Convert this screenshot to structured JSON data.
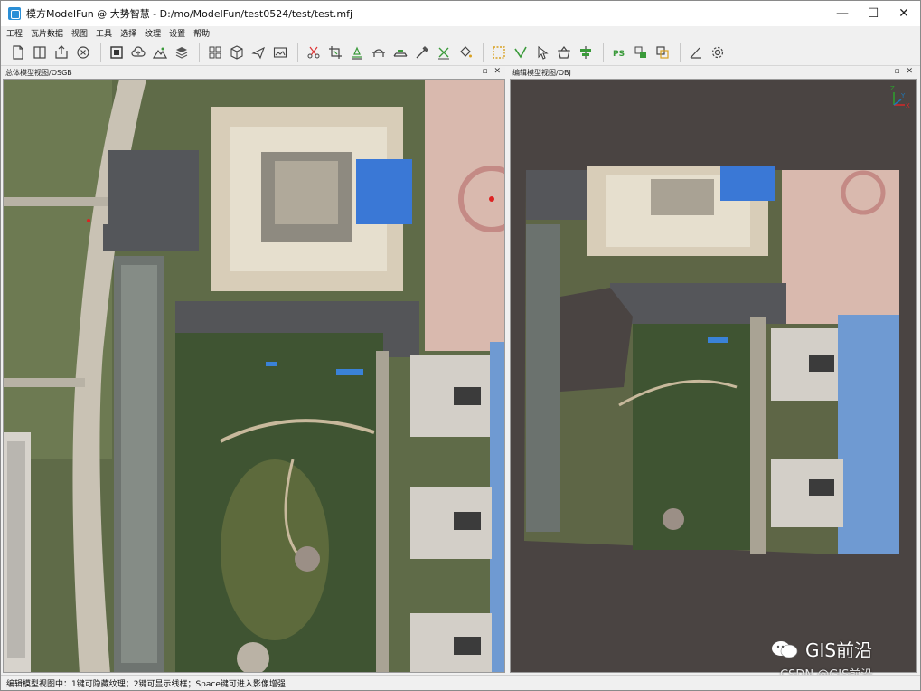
{
  "window": {
    "title": "模方ModelFun @ 大势智慧 - D:/mo/ModelFun/test0524/test/test.mfj"
  },
  "window_controls": {
    "minimize": "—",
    "maximize": "☐",
    "close": "✕"
  },
  "menu": [
    "工程",
    "瓦片数据",
    "视图",
    "工具",
    "选择",
    "纹理",
    "设置",
    "帮助"
  ],
  "toolbar_icons": [
    "new-file-icon",
    "split-view-icon",
    "export-icon",
    "close-circle-icon",
    "stop-icon",
    "cloud-upload-icon",
    "mountain-icon",
    "layers-icon",
    "grid-icon",
    "cube-icon",
    "airplane-icon",
    "image-icon",
    "scissors-icon",
    "crop-icon",
    "flatten-icon",
    "bridge-icon",
    "road-icon",
    "repair-icon",
    "erase-icon",
    "paint-bucket-icon",
    "select-box-icon",
    "check-select-icon",
    "pointer-select-icon",
    "basket-icon",
    "align-icon",
    "photoshop-icon",
    "texture-swap-icon",
    "texture-copy-icon",
    "angle-measure-icon",
    "settings-icon"
  ],
  "panels": {
    "left_title": "总体模型视图/OSGB",
    "right_title": "编辑模型视图/OBJ",
    "panel_controls": "▫ ✕"
  },
  "axis_gizmo": {
    "z": "Z",
    "x": "X",
    "y": "Y"
  },
  "status": "编辑模型视图中：1键可隐藏纹理；2键可显示线框；Space键可进入影像增强",
  "watermark": {
    "main": "GIS前沿",
    "sub": "CSDN @GIS前沿"
  },
  "colors": {
    "accent": "#2b8fd6",
    "viewport_bg": "#4a4442"
  }
}
